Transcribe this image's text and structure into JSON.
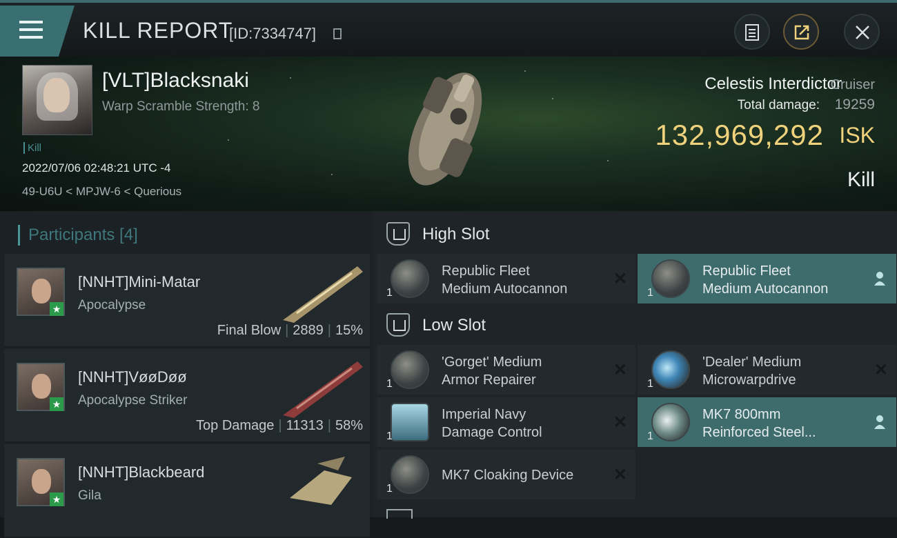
{
  "header": {
    "title": "KILL REPORT",
    "report_id": "[ID:7334747]"
  },
  "victim": {
    "name": "[VLT]Blacksnaki",
    "warp_scramble": "Warp Scramble Strength: 8",
    "kill_tag": "Kill",
    "datetime": "2022/07/06 02:48:21 UTC -4",
    "location": "49-U6U < MPJW-6 < Querious",
    "ship_name": "Celestis Interdictor",
    "ship_class": "Cruiser",
    "total_damage_label": "Total damage:",
    "total_damage": "19259",
    "isk_value": "132,969,292",
    "isk_unit": "ISK",
    "result": "Kill"
  },
  "participants": {
    "title": "Participants [4]",
    "items": [
      {
        "name": "[NNHT]Mini-Matar",
        "ship": "Apocalypse",
        "role": "Final Blow",
        "damage": "2889",
        "percent": "15%"
      },
      {
        "name": "[NNHT]VøøDøø",
        "ship": "Apocalypse Striker",
        "role": "Top Damage",
        "damage": "11313",
        "percent": "58%"
      },
      {
        "name": "[NNHT]Blackbeard",
        "ship": "Gila",
        "role": "",
        "damage": "",
        "percent": ""
      }
    ]
  },
  "fitting": {
    "high_slot_label": "High Slot",
    "low_slot_label": "Low Slot",
    "high": [
      {
        "qty": "1",
        "line1": "Republic Fleet",
        "line2": "Medium Autocannon",
        "state": "destroyed"
      },
      {
        "qty": "1",
        "line1": "Republic Fleet",
        "line2": "Medium Autocannon",
        "state": "dropped"
      }
    ],
    "low": [
      {
        "qty": "1",
        "line1": "'Gorget' Medium",
        "line2": "Armor Repairer",
        "state": "destroyed"
      },
      {
        "qty": "1",
        "line1": "'Dealer' Medium",
        "line2": "Microwarpdrive",
        "state": "destroyed"
      },
      {
        "qty": "1",
        "line1": "Imperial Navy",
        "line2": "Damage Control",
        "state": "destroyed"
      },
      {
        "qty": "1",
        "line1": "MK7 800mm",
        "line2": "Reinforced Steel...",
        "state": "dropped"
      },
      {
        "qty": "1",
        "line1": "MK7 Cloaking Device",
        "line2": "",
        "state": "destroyed"
      }
    ]
  },
  "colors": {
    "accent": "#3e6c6d",
    "isk": "#f0d27c",
    "badge": "#2b9a4a"
  }
}
